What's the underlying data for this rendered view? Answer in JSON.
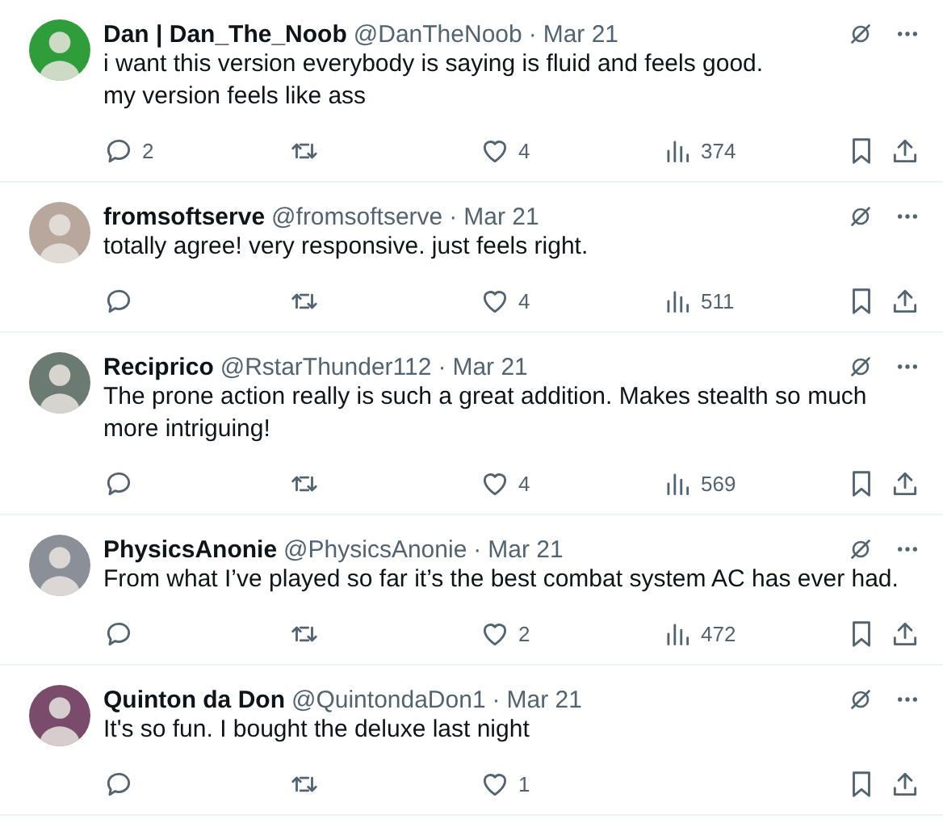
{
  "tweets": [
    {
      "name": "Dan | Dan_The_Noob",
      "handle": "@DanTheNoob",
      "sep": "·",
      "date": "Mar 21",
      "text": [
        "i want this version everybody is saying is fluid and feels good.",
        "my version feels like ass"
      ],
      "replies": "2",
      "likes": "4",
      "views": "374"
    },
    {
      "name": "fromsoftserve",
      "handle": "@fromsoftserve",
      "sep": "·",
      "date": "Mar 21",
      "text": [
        "totally agree! very responsive. just feels right."
      ],
      "likes": "4",
      "views": "511"
    },
    {
      "name": "Reciprico",
      "handle": "@RstarThunder112",
      "sep": "·",
      "date": "Mar 21",
      "text": [
        "The prone action really is such a great addition. Makes stealth so much more intriguing!"
      ],
      "likes": "4",
      "views": "569"
    },
    {
      "name": "PhysicsAnonie",
      "handle": "@PhysicsAnonie",
      "sep": "·",
      "date": "Mar 21",
      "text": [
        "From what I’ve played so far it’s the best combat system AC has ever had."
      ],
      "likes": "2",
      "views": "472"
    },
    {
      "name": "Quinton da Don",
      "handle": "@QuintondaDon1",
      "sep": "·",
      "date": "Mar 21",
      "text": [
        "It's so fun. I bought the deluxe last night"
      ],
      "likes": "1"
    }
  ]
}
